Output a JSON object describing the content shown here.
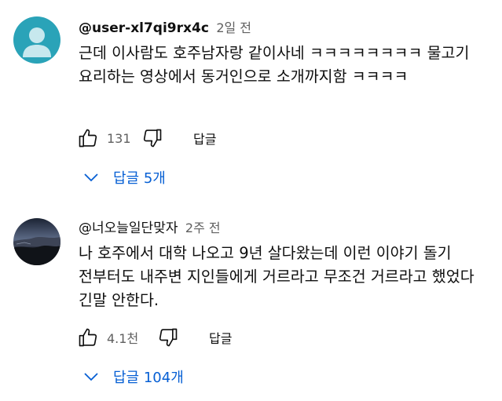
{
  "comments": [
    {
      "author": "@user-xl7qi9rx4c",
      "time": "2일 전",
      "text": "근데 이사람도 호주남자랑 같이사네 ㅋㅋㅋㅋㅋㅋㅋㅋ 물고기 요리하는 영상에서 동거인으로 소개까지함 ㅋㅋㅋㅋ",
      "likes": "131",
      "reply_label": "답글",
      "replies_label": "답글 5개",
      "avatar": "default-person-avatar"
    },
    {
      "author": "@너오늘일단맞자",
      "time": "2주 전",
      "text": "나 호주에서 대학 나오고 9년 살다왔는데 이런 이야기 돌기 전부터도 내주변 지인들에게 거르라고 무조건 거르라고 했었다 긴말 안한다.",
      "likes": "4.1천",
      "reply_label": "답글",
      "replies_label": "답글 104개",
      "avatar": "night-landscape-photo-avatar"
    }
  ],
  "colors": {
    "link": "#065fd4",
    "secondary_text": "#606060",
    "avatar_bg": "#2aa3b8"
  }
}
